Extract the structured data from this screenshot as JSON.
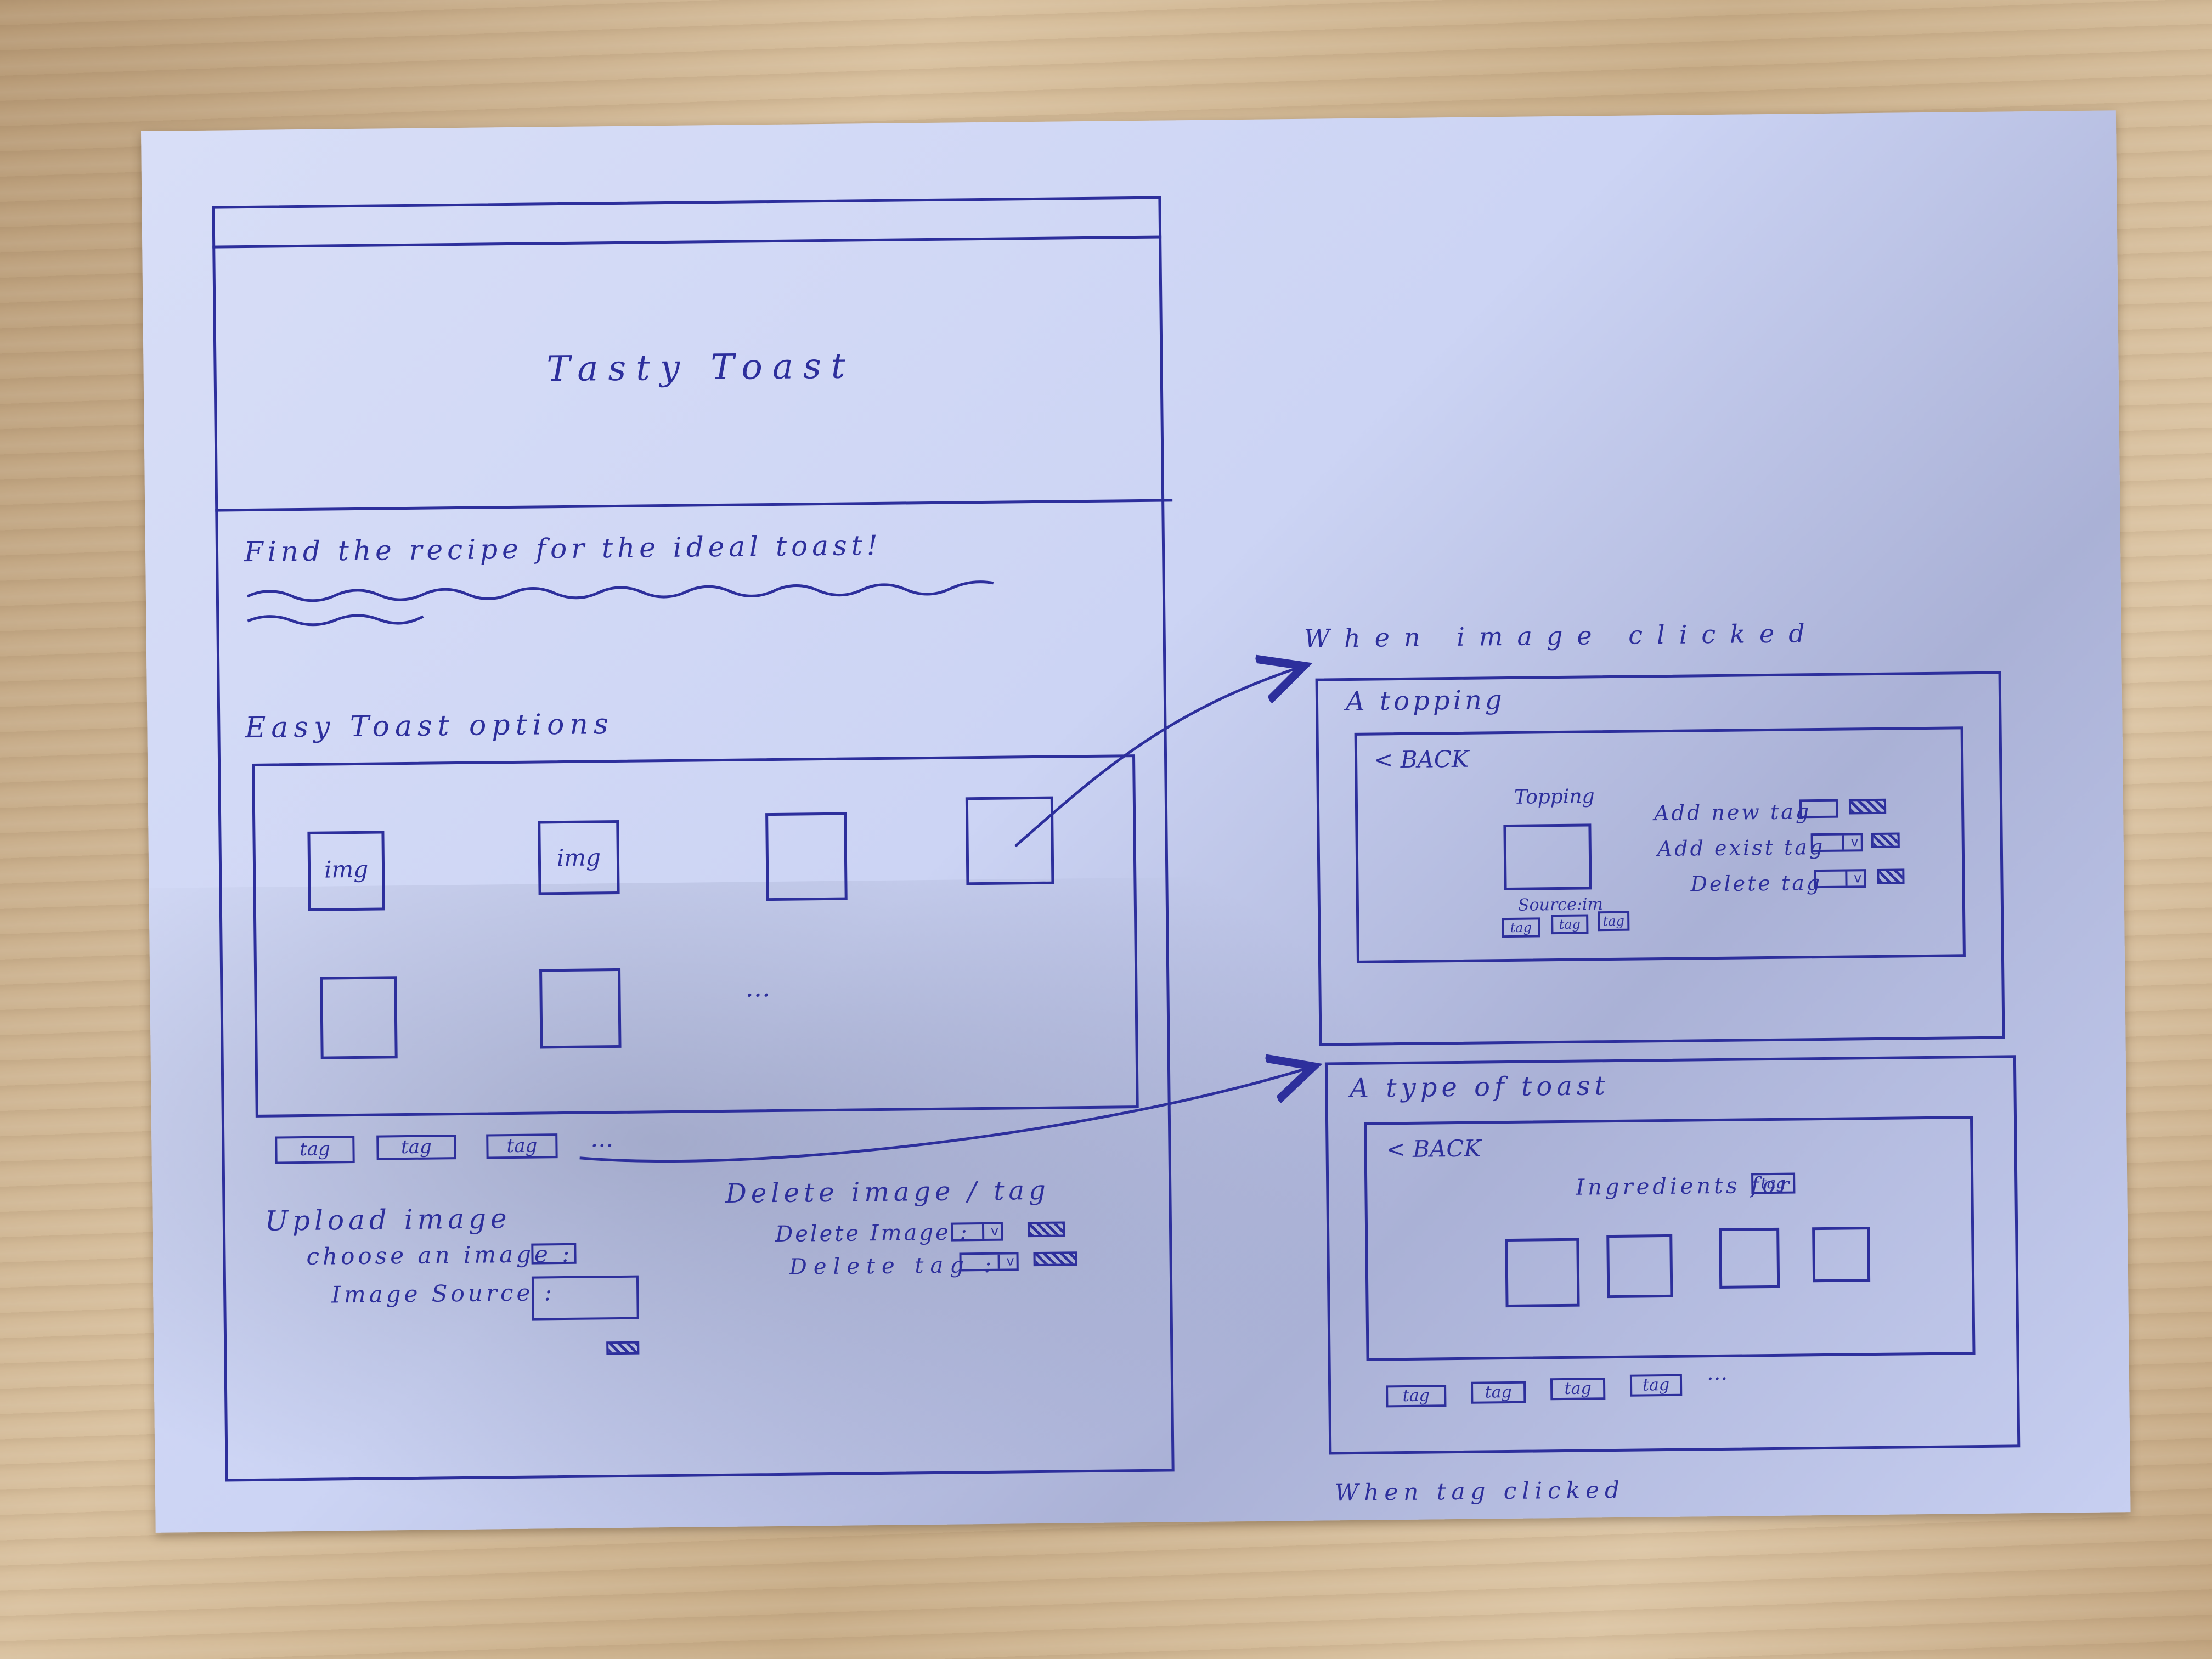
{
  "main": {
    "title": "Tasty Toast",
    "tagline": "Find the recipe for the ideal toast!",
    "section_title": "Easy Toast options",
    "gallery": [
      {
        "label": "img"
      },
      {
        "label": "img"
      },
      {
        "label": ""
      },
      {
        "label": ""
      },
      {
        "label": ""
      },
      {
        "label": ""
      }
    ],
    "gallery_more": "...",
    "tags": [
      "tag",
      "tag",
      "tag"
    ],
    "tags_more": "...",
    "upload": {
      "title": "Upload image",
      "choose_label": "choose an image :",
      "source_label": "Image Source :"
    },
    "delete": {
      "title": "Delete image / tag",
      "image_label": "Delete Image :",
      "tag_label": "Delete tag :"
    }
  },
  "topping_view": {
    "annotation": "When image clicked",
    "title": "A topping",
    "back": "< BACK",
    "image_caption": "Topping",
    "source_caption": "Source:im",
    "tags": [
      "tag",
      "tag",
      "tag"
    ],
    "add_new_label": "Add new tag",
    "add_exist_label": "Add exist tag",
    "delete_label": "Delete tag"
  },
  "toast_view": {
    "title": "A type of toast",
    "back": "< BACK",
    "ingredients_label": "Ingredients for",
    "ingredients_tag": "tag",
    "tags": [
      "tag",
      "tag",
      "tag",
      "tag"
    ],
    "tags_more": "...",
    "annotation": "When tag clicked"
  },
  "colors": {
    "ink": "#2d2f9c",
    "paper": "#ccd4f4",
    "table": "#c8ad88"
  }
}
